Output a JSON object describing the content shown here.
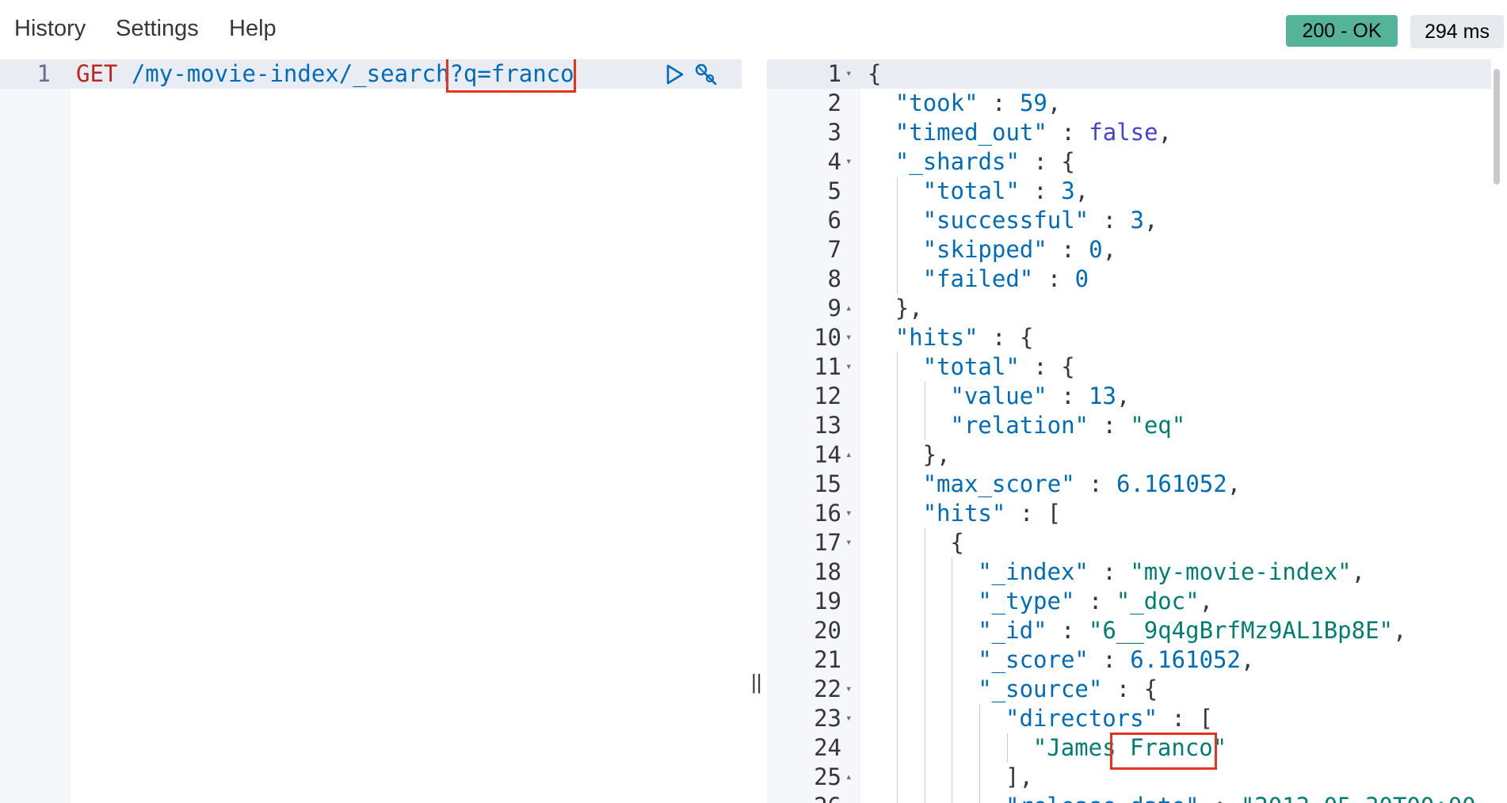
{
  "menu": {
    "history_label": "History",
    "settings_label": "Settings",
    "help_label": "Help"
  },
  "status": {
    "code_text": "200 - OK",
    "time_text": "294 ms",
    "ok_color": "#54b399"
  },
  "request": {
    "line_number": "1",
    "method": "GET",
    "path": " /my-movie-index/_search?",
    "query": "q=franco"
  },
  "icons": {
    "run": "play-icon",
    "settings": "wrench-icon",
    "resize": "column-resize-handle"
  },
  "divider_handle_text": "||",
  "response_lines": [
    {
      "n": "1",
      "fold": "down",
      "indent": 0,
      "tokens": [
        [
          "p",
          "{"
        ]
      ]
    },
    {
      "n": "2",
      "fold": "",
      "indent": 1,
      "tokens": [
        [
          "k",
          "\"took\""
        ],
        [
          "p",
          " : "
        ],
        [
          "n",
          "59"
        ],
        [
          "p",
          ","
        ]
      ]
    },
    {
      "n": "3",
      "fold": "",
      "indent": 1,
      "tokens": [
        [
          "k",
          "\"timed_out\""
        ],
        [
          "p",
          " : "
        ],
        [
          "b",
          "false"
        ],
        [
          "p",
          ","
        ]
      ]
    },
    {
      "n": "4",
      "fold": "down",
      "indent": 1,
      "tokens": [
        [
          "k",
          "\"_shards\""
        ],
        [
          "p",
          " : {"
        ]
      ]
    },
    {
      "n": "5",
      "fold": "",
      "indent": 2,
      "tokens": [
        [
          "k",
          "\"total\""
        ],
        [
          "p",
          " : "
        ],
        [
          "n",
          "3"
        ],
        [
          "p",
          ","
        ]
      ]
    },
    {
      "n": "6",
      "fold": "",
      "indent": 2,
      "tokens": [
        [
          "k",
          "\"successful\""
        ],
        [
          "p",
          " : "
        ],
        [
          "n",
          "3"
        ],
        [
          "p",
          ","
        ]
      ]
    },
    {
      "n": "7",
      "fold": "",
      "indent": 2,
      "tokens": [
        [
          "k",
          "\"skipped\""
        ],
        [
          "p",
          " : "
        ],
        [
          "n",
          "0"
        ],
        [
          "p",
          ","
        ]
      ]
    },
    {
      "n": "8",
      "fold": "",
      "indent": 2,
      "tokens": [
        [
          "k",
          "\"failed\""
        ],
        [
          "p",
          " : "
        ],
        [
          "n",
          "0"
        ]
      ]
    },
    {
      "n": "9",
      "fold": "up",
      "indent": 1,
      "tokens": [
        [
          "p",
          "},"
        ]
      ]
    },
    {
      "n": "10",
      "fold": "down",
      "indent": 1,
      "tokens": [
        [
          "k",
          "\"hits\""
        ],
        [
          "p",
          " : {"
        ]
      ]
    },
    {
      "n": "11",
      "fold": "down",
      "indent": 2,
      "tokens": [
        [
          "k",
          "\"total\""
        ],
        [
          "p",
          " : {"
        ]
      ]
    },
    {
      "n": "12",
      "fold": "",
      "indent": 3,
      "tokens": [
        [
          "k",
          "\"value\""
        ],
        [
          "p",
          " : "
        ],
        [
          "n",
          "13"
        ],
        [
          "p",
          ","
        ]
      ]
    },
    {
      "n": "13",
      "fold": "",
      "indent": 3,
      "tokens": [
        [
          "k",
          "\"relation\""
        ],
        [
          "p",
          " : "
        ],
        [
          "s",
          "\"eq\""
        ]
      ]
    },
    {
      "n": "14",
      "fold": "up",
      "indent": 2,
      "tokens": [
        [
          "p",
          "},"
        ]
      ]
    },
    {
      "n": "15",
      "fold": "",
      "indent": 2,
      "tokens": [
        [
          "k",
          "\"max_score\""
        ],
        [
          "p",
          " : "
        ],
        [
          "n",
          "6.161052"
        ],
        [
          "p",
          ","
        ]
      ]
    },
    {
      "n": "16",
      "fold": "down",
      "indent": 2,
      "tokens": [
        [
          "k",
          "\"hits\""
        ],
        [
          "p",
          " : ["
        ]
      ]
    },
    {
      "n": "17",
      "fold": "down",
      "indent": 3,
      "tokens": [
        [
          "p",
          "{"
        ]
      ]
    },
    {
      "n": "18",
      "fold": "",
      "indent": 4,
      "tokens": [
        [
          "k",
          "\"_index\""
        ],
        [
          "p",
          " : "
        ],
        [
          "s",
          "\"my-movie-index\""
        ],
        [
          "p",
          ","
        ]
      ]
    },
    {
      "n": "19",
      "fold": "",
      "indent": 4,
      "tokens": [
        [
          "k",
          "\"_type\""
        ],
        [
          "p",
          " : "
        ],
        [
          "s",
          "\"_doc\""
        ],
        [
          "p",
          ","
        ]
      ]
    },
    {
      "n": "20",
      "fold": "",
      "indent": 4,
      "tokens": [
        [
          "k",
          "\"_id\""
        ],
        [
          "p",
          " : "
        ],
        [
          "s",
          "\"6__9q4gBrfMz9AL1Bp8E\""
        ],
        [
          "p",
          ","
        ]
      ]
    },
    {
      "n": "21",
      "fold": "",
      "indent": 4,
      "tokens": [
        [
          "k",
          "\"_score\""
        ],
        [
          "p",
          " : "
        ],
        [
          "n",
          "6.161052"
        ],
        [
          "p",
          ","
        ]
      ]
    },
    {
      "n": "22",
      "fold": "down",
      "indent": 4,
      "tokens": [
        [
          "k",
          "\"_source\""
        ],
        [
          "p",
          " : {"
        ]
      ]
    },
    {
      "n": "23",
      "fold": "down",
      "indent": 5,
      "tokens": [
        [
          "k",
          "\"directors\""
        ],
        [
          "p",
          " : ["
        ]
      ]
    },
    {
      "n": "24",
      "fold": "",
      "indent": 6,
      "tokens": [
        [
          "s",
          "\"James Franco\""
        ]
      ]
    },
    {
      "n": "25",
      "fold": "up",
      "indent": 5,
      "tokens": [
        [
          "p",
          "],"
        ]
      ]
    },
    {
      "n": "26",
      "fold": "",
      "indent": 5,
      "tokens": [
        [
          "k",
          "\"release_date\""
        ],
        [
          "p",
          " : "
        ],
        [
          "s",
          "\"2013-05-30T00:00"
        ]
      ]
    }
  ]
}
